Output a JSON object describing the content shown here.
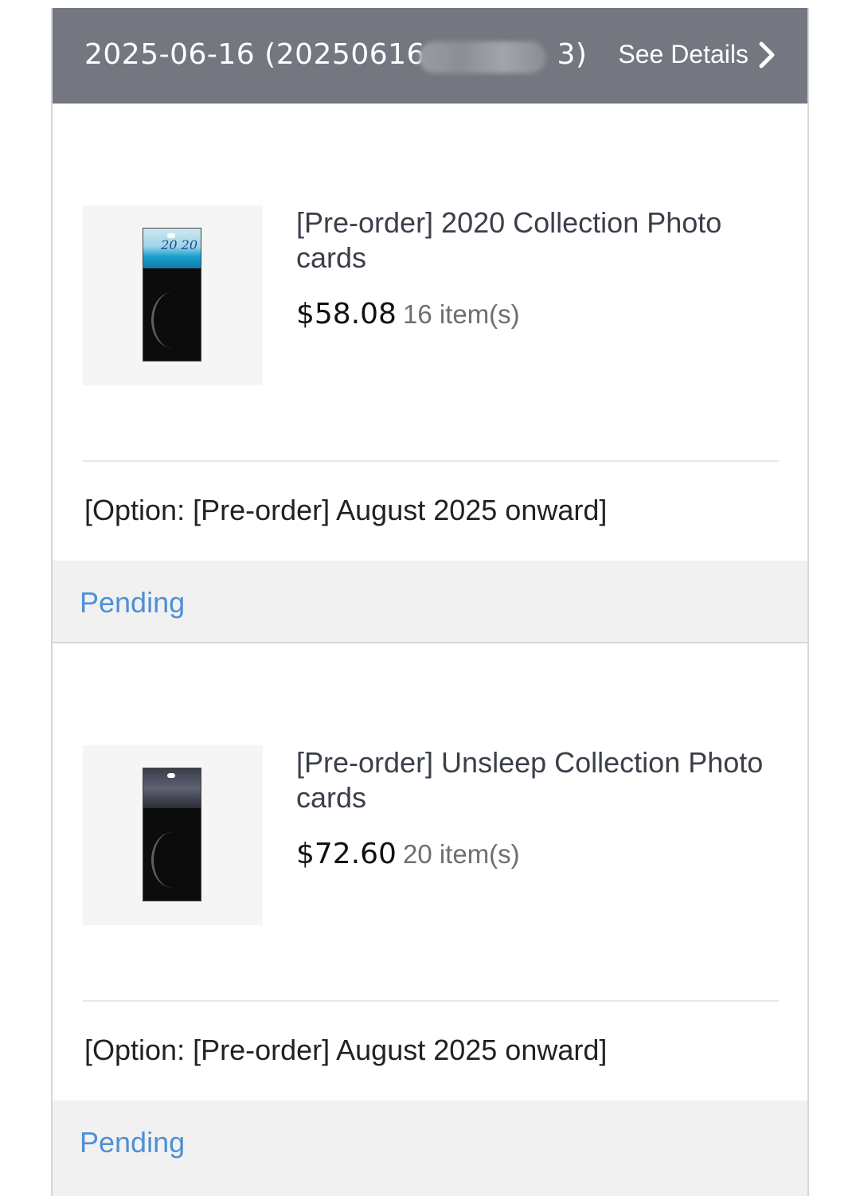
{
  "order": {
    "id_prefix": "2025-06-16 (20250616-",
    "id_suffix": "3)",
    "see_details_label": "See Details"
  },
  "items": [
    {
      "title": "[Pre-order] 2020 Collection Photo cards",
      "price": "$58.08",
      "quantity": "16 item(s)",
      "option": "[Option: [Pre-order] August 2025 onward]",
      "status": "Pending",
      "tag_mark": "20 20"
    },
    {
      "title": "[Pre-order] Unsleep Collection Photo cards",
      "price": "$72.60",
      "quantity": "20 item(s)",
      "option": "[Option: [Pre-order] August 2025 onward]",
      "status": "Pending",
      "tag_mark": ""
    }
  ],
  "colors": {
    "header_bg": "#747780",
    "status_text": "#4f8fd6",
    "status_bg": "#f1f1f1"
  },
  "icons": {
    "details": "chevron-right-icon",
    "redaction": "blurred-redaction"
  }
}
